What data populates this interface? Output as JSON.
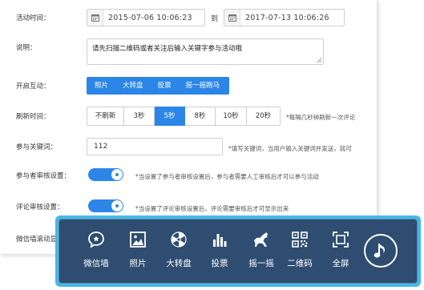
{
  "form": {
    "activity_time_label": "活动时间：",
    "start_datetime": "2015-07-06 10:06:23",
    "to_label": "到",
    "end_datetime": "2017-07-13 10:06:26",
    "description_label": "说明：",
    "description_value": "请先扫描二维码或者关注后输入关键字参与活动哦",
    "open_interaction_label": "开启互动：",
    "interaction_buttons": [
      "照片",
      "大转盘",
      "投票",
      "摇一摇跑马"
    ],
    "refresh_time_label": "刷新时间：",
    "refresh_options": [
      "不刷新",
      "3秒",
      "5秒",
      "8秒",
      "10秒",
      "20秒"
    ],
    "refresh_selected": "5秒",
    "refresh_hint": "*每隔几秒钟刷新一次评论",
    "keyword_label": "参与关键词：",
    "keyword_value": "112",
    "keyword_hint": "*填写关键词，当用户输入关键词并发送，就可",
    "participant_review_label": "参与者审核设置：",
    "participant_review_on": true,
    "participant_review_hint": "*当设置了参与者审核设置后，参与者需要人工审核后才可以参与活动",
    "comment_review_label": "评论审核设置：",
    "comment_review_on": true,
    "comment_review_hint": "*当设置了评论审核设置后，评论需要审核后才可显示出来",
    "scroll_label_partial": "微信墙滚动显"
  },
  "toolbar": {
    "items": [
      {
        "label": "微信墙",
        "icon": "wechat-wall-icon"
      },
      {
        "label": "照片",
        "icon": "photo-icon"
      },
      {
        "label": "大转盘",
        "icon": "wheel-icon"
      },
      {
        "label": "投票",
        "icon": "vote-icon"
      },
      {
        "label": "摇一摇",
        "icon": "horse-icon"
      },
      {
        "label": "二维码",
        "icon": "qrcode-icon"
      },
      {
        "label": "全屏",
        "icon": "fullscreen-icon"
      }
    ],
    "music_icon": "music-note-icon"
  },
  "colors": {
    "accent": "#2b86e8",
    "toolbar_bg": "#2e4d70",
    "toolbar_border": "#45b8e6"
  }
}
